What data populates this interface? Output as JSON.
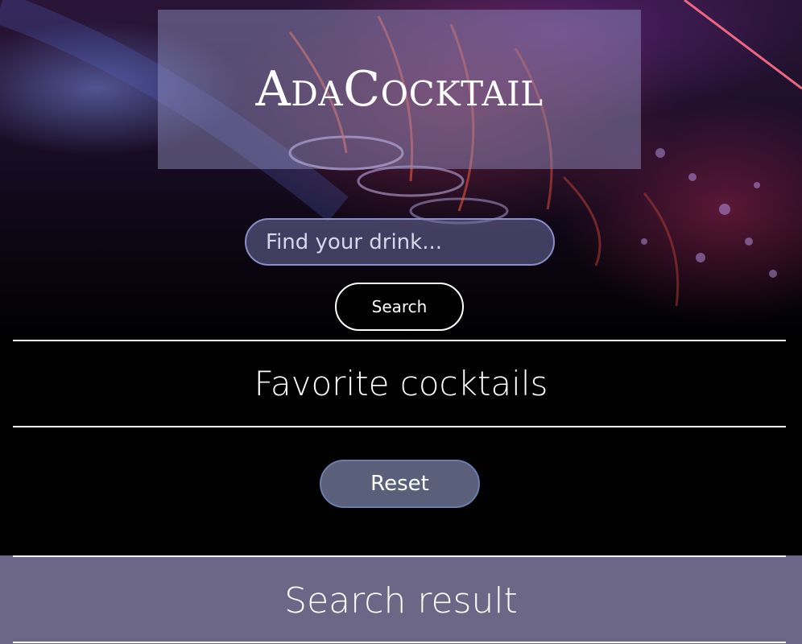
{
  "header": {
    "logo_text": "AdaCocktail"
  },
  "search": {
    "placeholder": "Find your drink...",
    "value": "",
    "button_label": "Search"
  },
  "favorites": {
    "title": "Favorite cocktails",
    "reset_label": "Reset"
  },
  "results": {
    "title": "Search result"
  },
  "colors": {
    "logo_box": "#9696c8",
    "input_border": "#8d8ec7",
    "reset_bg": "#5a607a",
    "results_band": "#6c6687"
  }
}
